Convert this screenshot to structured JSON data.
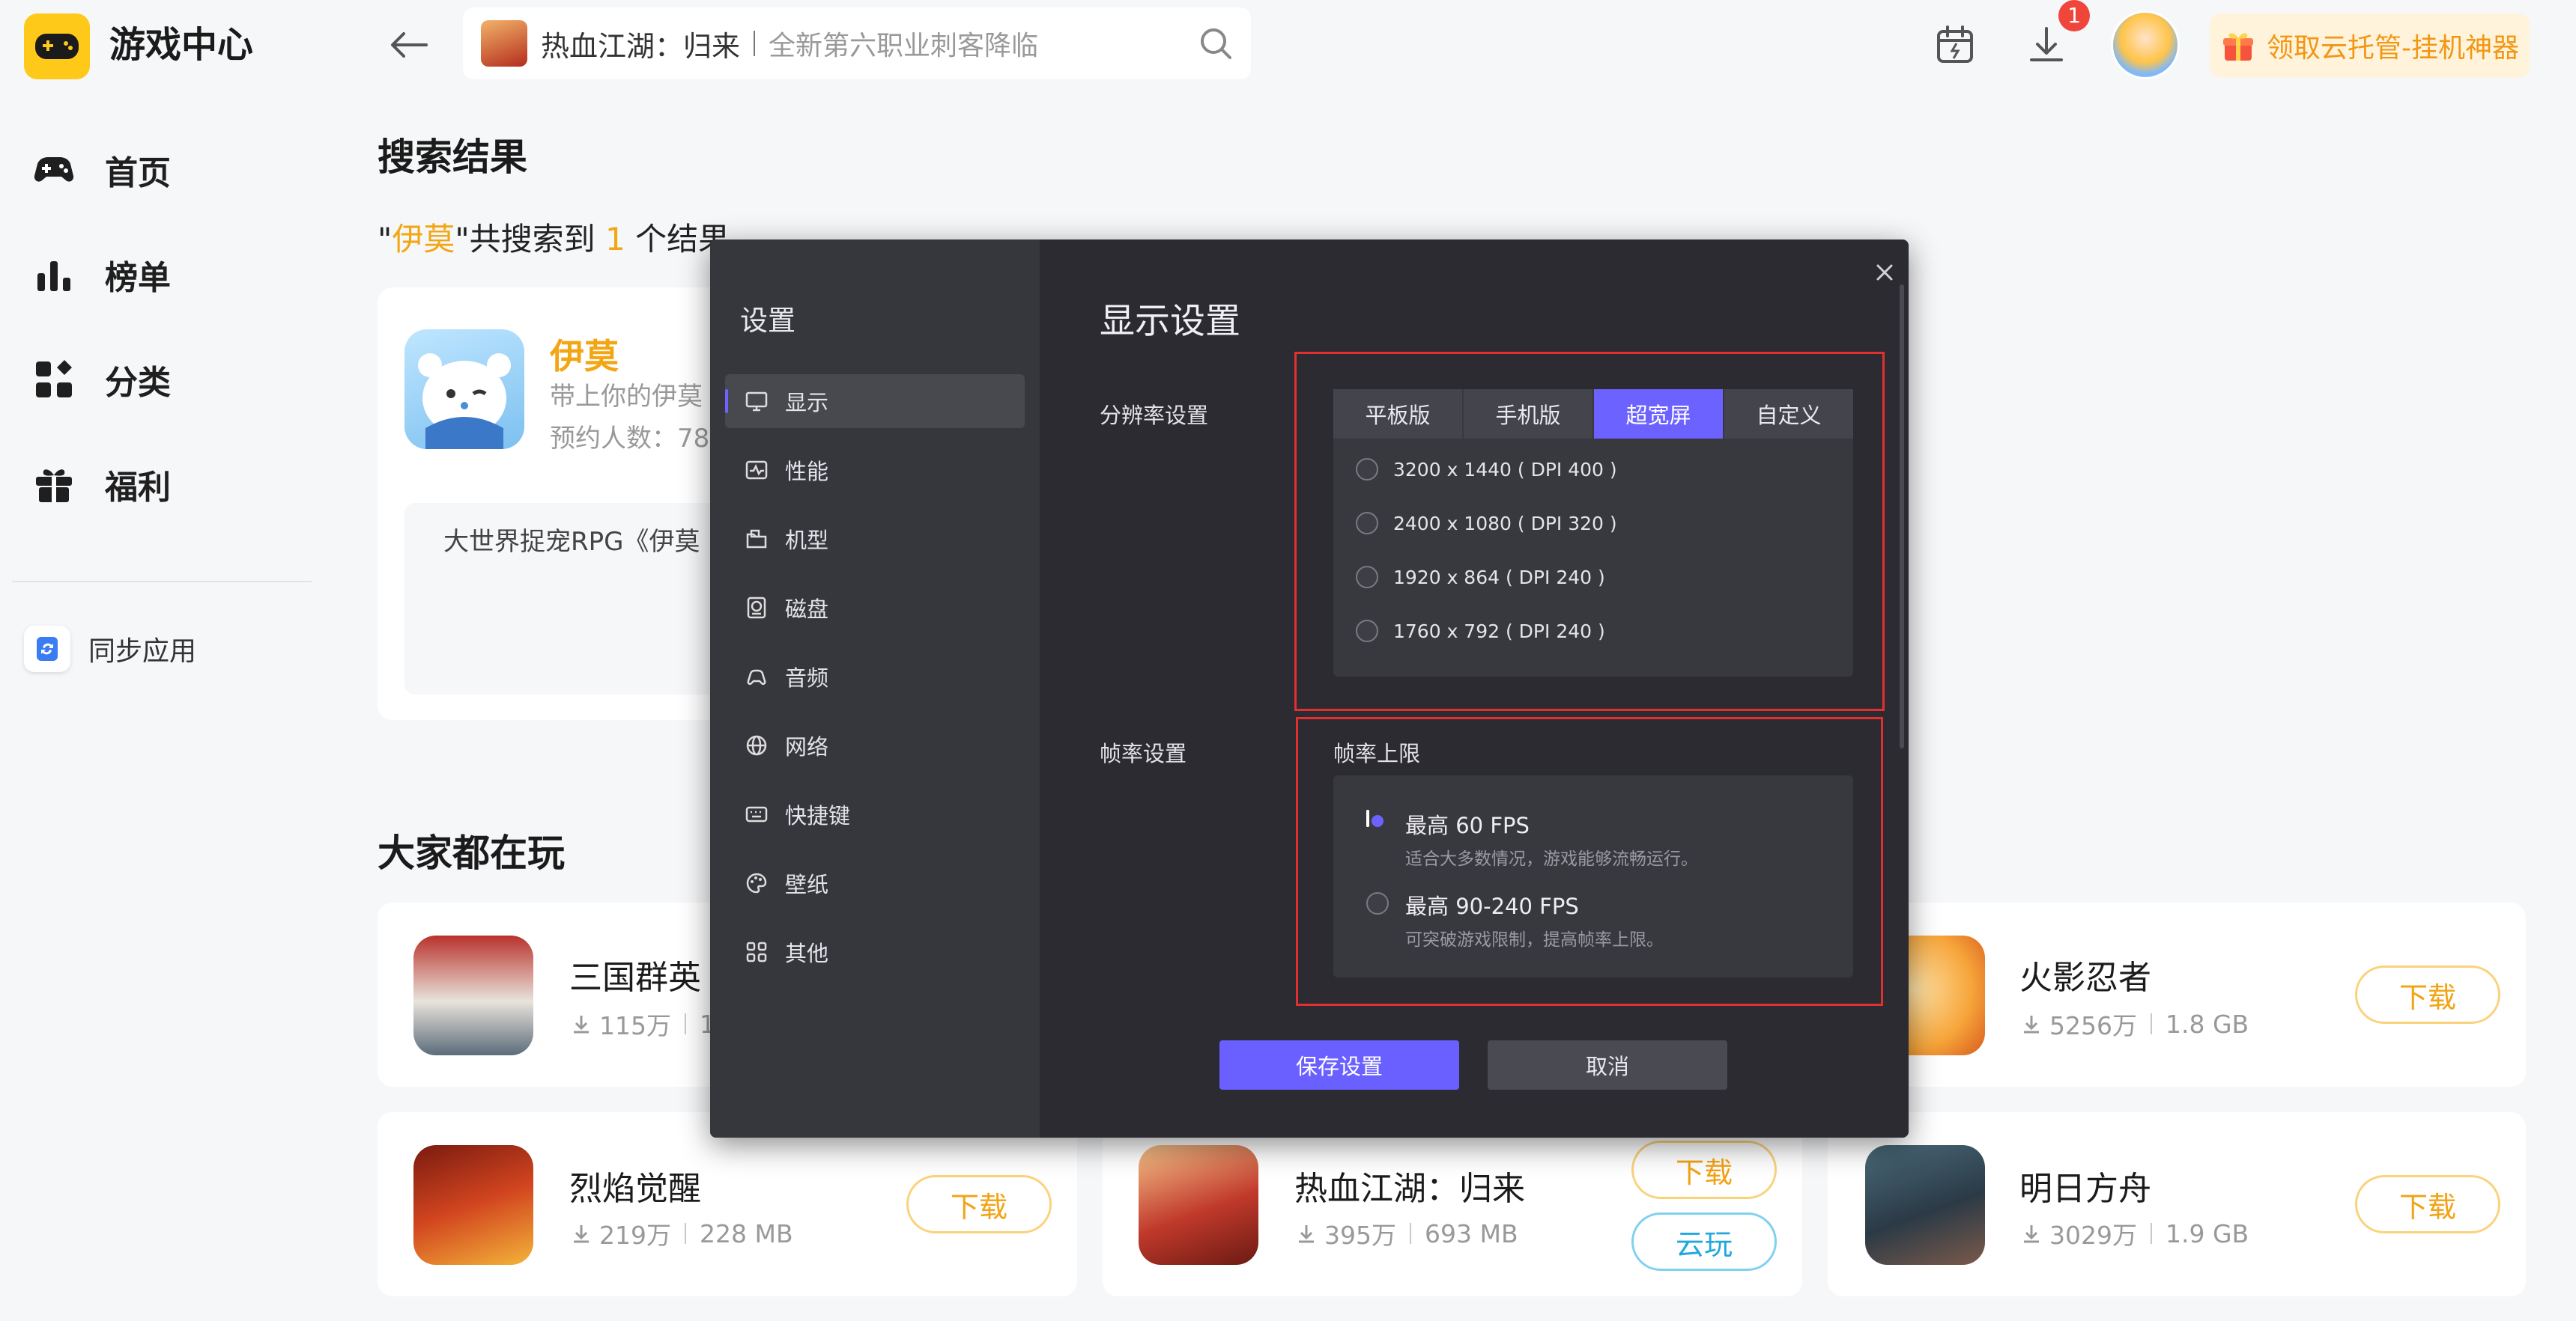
{
  "app": {
    "name": "游戏中心"
  },
  "sidebar": {
    "items": [
      {
        "label": "首页",
        "icon": "gamepad-icon"
      },
      {
        "label": "榜单",
        "icon": "ranking-icon"
      },
      {
        "label": "分类",
        "icon": "category-icon"
      },
      {
        "label": "福利",
        "icon": "gift-icon"
      }
    ],
    "sync_label": "同步应用"
  },
  "topbar": {
    "search_game": "热血江湖：归来",
    "search_hint": "全新第六职业刺客降临",
    "download_badge": "1",
    "cloud_button": "领取云托管-挂机神器"
  },
  "results": {
    "title": "搜索结果",
    "query_prefix": "\"",
    "query": "伊莫",
    "query_mid": "\"共搜索到 ",
    "count": "1",
    "query_suffix": " 个结果",
    "game_name": "伊莫",
    "game_desc": "带上你的伊莫",
    "game_reserve": "预约人数：78",
    "game_intro": "大世界捉宠RPG《伊莫"
  },
  "popular": {
    "title": "大家都在玩",
    "games": [
      {
        "name": "三国群英",
        "downloads": "115万",
        "size": "1"
      },
      {
        "name": "火影忍者",
        "downloads": "5256万",
        "size": "1.8 GB",
        "button": "下载"
      },
      {
        "name": "烈焰觉醒",
        "downloads": "219万",
        "size": "228 MB",
        "button": "下载"
      },
      {
        "name": "热血江湖：归来",
        "downloads": "395万",
        "size": "693 MB",
        "button": "下载",
        "button2": "云玩"
      },
      {
        "name": "明日方舟",
        "downloads": "3029万",
        "size": "1.9 GB",
        "button": "下载"
      }
    ]
  },
  "settings": {
    "sidebar_title": "设置",
    "menu": [
      {
        "label": "显示",
        "icon": "monitor-icon"
      },
      {
        "label": "性能",
        "icon": "performance-icon"
      },
      {
        "label": "机型",
        "icon": "device-model-icon"
      },
      {
        "label": "磁盘",
        "icon": "disk-icon"
      },
      {
        "label": "音频",
        "icon": "audio-icon"
      },
      {
        "label": "网络",
        "icon": "globe-icon"
      },
      {
        "label": "快捷键",
        "icon": "keyboard-icon"
      },
      {
        "label": "壁纸",
        "icon": "palette-icon"
      },
      {
        "label": "其他",
        "icon": "grid-icon"
      }
    ],
    "active_menu": "显示",
    "title": "显示设置",
    "resolution_label": "分辨率设置",
    "tabs": [
      "平板版",
      "手机版",
      "超宽屏",
      "自定义"
    ],
    "active_tab": "超宽屏",
    "resolutions": [
      "3200 x 1440 ( DPI 400 )",
      "2400 x 1080 ( DPI 320 )",
      "1920 x 864 ( DPI 240 )",
      "1760 x 792 ( DPI 240 )"
    ],
    "fps_label": "帧率设置",
    "fps_cap_label": "帧率上限",
    "fps_options": [
      {
        "main": "最高 60 FPS",
        "sub": "适合大多数情况，游戏能够流畅运行。",
        "selected": true
      },
      {
        "main": "最高 90-240 FPS",
        "sub": "可突破游戏限制，提高帧率上限。",
        "selected": false
      }
    ],
    "save": "保存设置",
    "cancel": "取消"
  },
  "colors": {
    "accent": "#6c62ff",
    "brand_yellow": "#ffc91a",
    "highlight_orange": "#f3a614",
    "frame_red": "#e23030"
  }
}
